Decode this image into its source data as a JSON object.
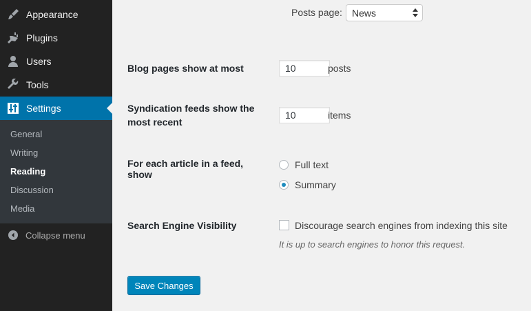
{
  "sidebar": {
    "items": [
      {
        "label": "Appearance",
        "icon": "paintbrush-icon"
      },
      {
        "label": "Plugins",
        "icon": "plugin-icon"
      },
      {
        "label": "Users",
        "icon": "user-icon"
      },
      {
        "label": "Tools",
        "icon": "wrench-icon"
      },
      {
        "label": "Settings",
        "icon": "settings-sliders-icon",
        "active": true
      }
    ],
    "submenu": [
      {
        "label": "General"
      },
      {
        "label": "Writing"
      },
      {
        "label": "Reading",
        "current": true
      },
      {
        "label": "Discussion"
      },
      {
        "label": "Media"
      }
    ],
    "collapse_label": "Collapse menu",
    "active_color": "#0073aa"
  },
  "form": {
    "posts_page": {
      "label": "Posts page:",
      "value": "News"
    },
    "blog_pages": {
      "label": "Blog pages show at most",
      "value": "10",
      "unit": "posts"
    },
    "syndication": {
      "label_line1": "Syndication feeds show the",
      "label_line2": "most recent",
      "value": "10",
      "unit": "items"
    },
    "feed_article": {
      "label_line1": "For each article in a feed,",
      "label_line2": "show",
      "options": [
        {
          "label": "Full text",
          "checked": false
        },
        {
          "label": "Summary",
          "checked": true
        }
      ]
    },
    "search_visibility": {
      "label": "Search Engine Visibility",
      "checkbox_label": "Discourage search engines from indexing this site",
      "checked": false,
      "description": "It is up to search engines to honor this request."
    },
    "save_button": "Save Changes"
  }
}
